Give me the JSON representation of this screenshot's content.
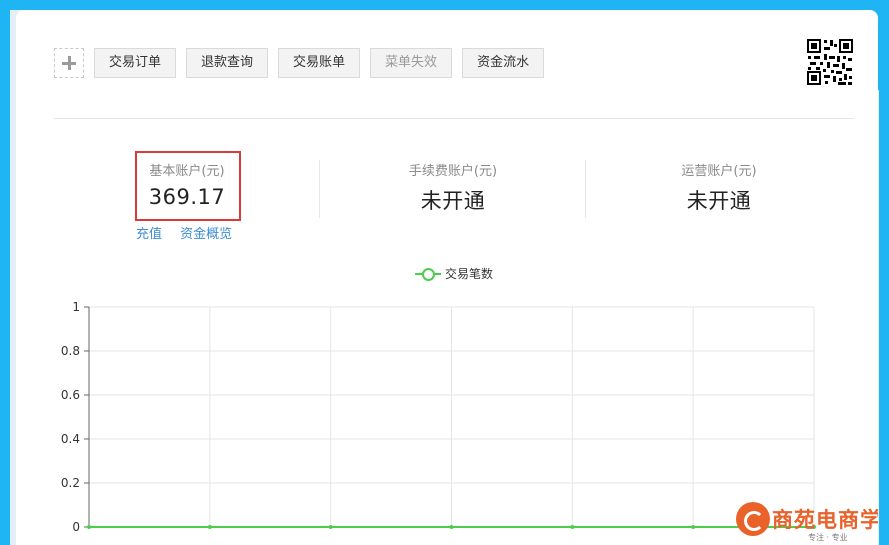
{
  "toolbar": {
    "buttons": [
      {
        "label": "交易订单",
        "disabled": false
      },
      {
        "label": "退款查询",
        "disabled": false
      },
      {
        "label": "交易账单",
        "disabled": false
      },
      {
        "label": "菜单失效",
        "disabled": true
      },
      {
        "label": "资金流水",
        "disabled": false
      }
    ]
  },
  "accounts": [
    {
      "label": "基本账户(元)",
      "value": "369.17"
    },
    {
      "label": "手续费账户(元)",
      "value": "未开通"
    },
    {
      "label": "运营账户(元)",
      "value": "未开通"
    }
  ],
  "account_links": [
    "充值",
    "资金概览"
  ],
  "chart_data": {
    "type": "line",
    "legend": "交易笔数",
    "legend_position": "top-center",
    "y_ticks": [
      "1",
      "0.8",
      "0.6",
      "0.4",
      "0.2",
      "0"
    ],
    "ylim": [
      0,
      1
    ],
    "series": [
      {
        "name": "交易笔数",
        "values": [
          0,
          0,
          0,
          0,
          0,
          0,
          0
        ],
        "color": "#4cce4c"
      }
    ],
    "grid": true
  },
  "watermark": {
    "title": "商苑电商学院",
    "subtitle": "专注 · 专业"
  },
  "colors": {
    "accent": "#1fb4f3",
    "highlight": "#d93a3a",
    "link": "#3d8ed4",
    "series": "#4cce4c"
  }
}
